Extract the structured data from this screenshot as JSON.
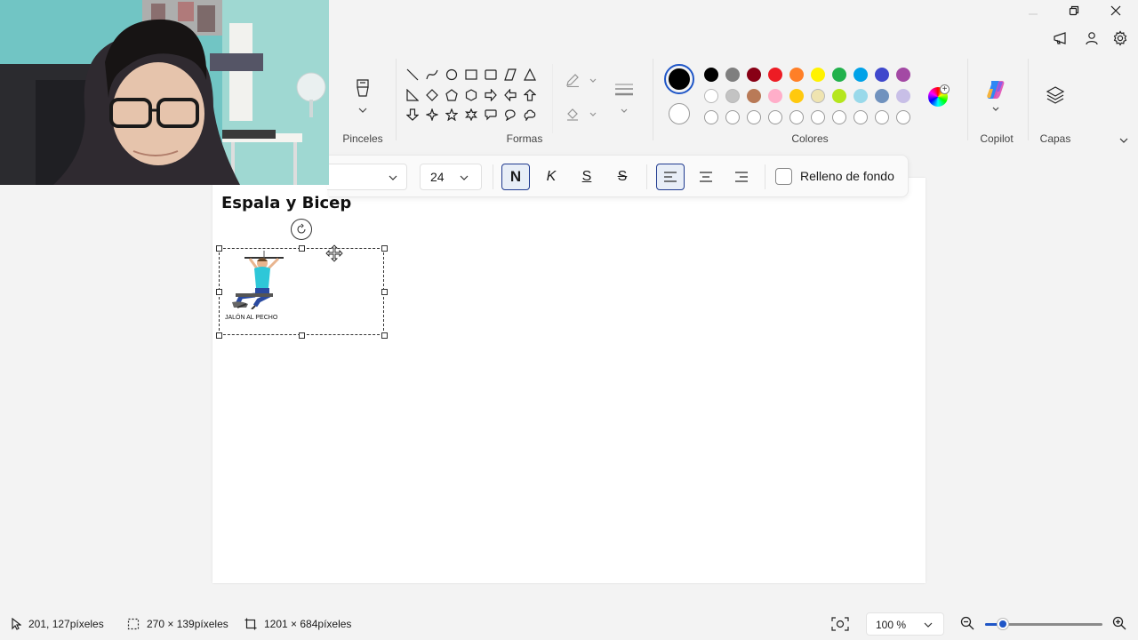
{
  "ribbon": {
    "brushes_label": "Pinceles",
    "shapes_label": "Formas",
    "colors_label": "Colores",
    "copilot_label": "Copilot",
    "layers_label": "Capas",
    "shape_icons": [
      "line-icon",
      "curve-icon",
      "oval-icon",
      "rectangle-icon",
      "rounded-rectangle-icon",
      "polygon-icon",
      "triangle-icon",
      "right-triangle-icon",
      "diamond-icon",
      "pentagon-icon",
      "hexagon-icon",
      "right-arrow-icon",
      "left-arrow-icon",
      "up-arrow-icon",
      "down-arrow-icon",
      "four-point-star-icon",
      "five-point-star-icon",
      "six-point-star-icon",
      "rounded-callout-icon",
      "oval-callout-icon",
      "cloud-callout-icon"
    ],
    "palette_row1": [
      "#000000",
      "#7f7f7f",
      "#880015",
      "#ed1c24",
      "#ff7f27",
      "#fff200",
      "#22b14c",
      "#00a2e8",
      "#3f48cc",
      "#a349a4"
    ],
    "palette_row2": [
      "#ffffff",
      "#c3c3c3",
      "#b97a57",
      "#ffaec9",
      "#ffc90e",
      "#efe4b0",
      "#b5e61d",
      "#99d9ea",
      "#7092be",
      "#c8bfe7"
    ],
    "primary_color": "#000000",
    "secondary_color": "#ffffff"
  },
  "text_toolbar": {
    "font_size": "24",
    "bold": "N",
    "italic": "K",
    "underline": "S",
    "strikethrough": "S",
    "background_fill_label": "Relleno de fondo"
  },
  "canvas": {
    "heading": "Espala y Bicep",
    "image_caption": "JALÓN AL PECHO"
  },
  "status": {
    "cursor_pos": "201, 127píxeles",
    "selection_size": "270 × 139píxeles",
    "canvas_size": "1201 × 684píxeles",
    "zoom": "100 %"
  }
}
